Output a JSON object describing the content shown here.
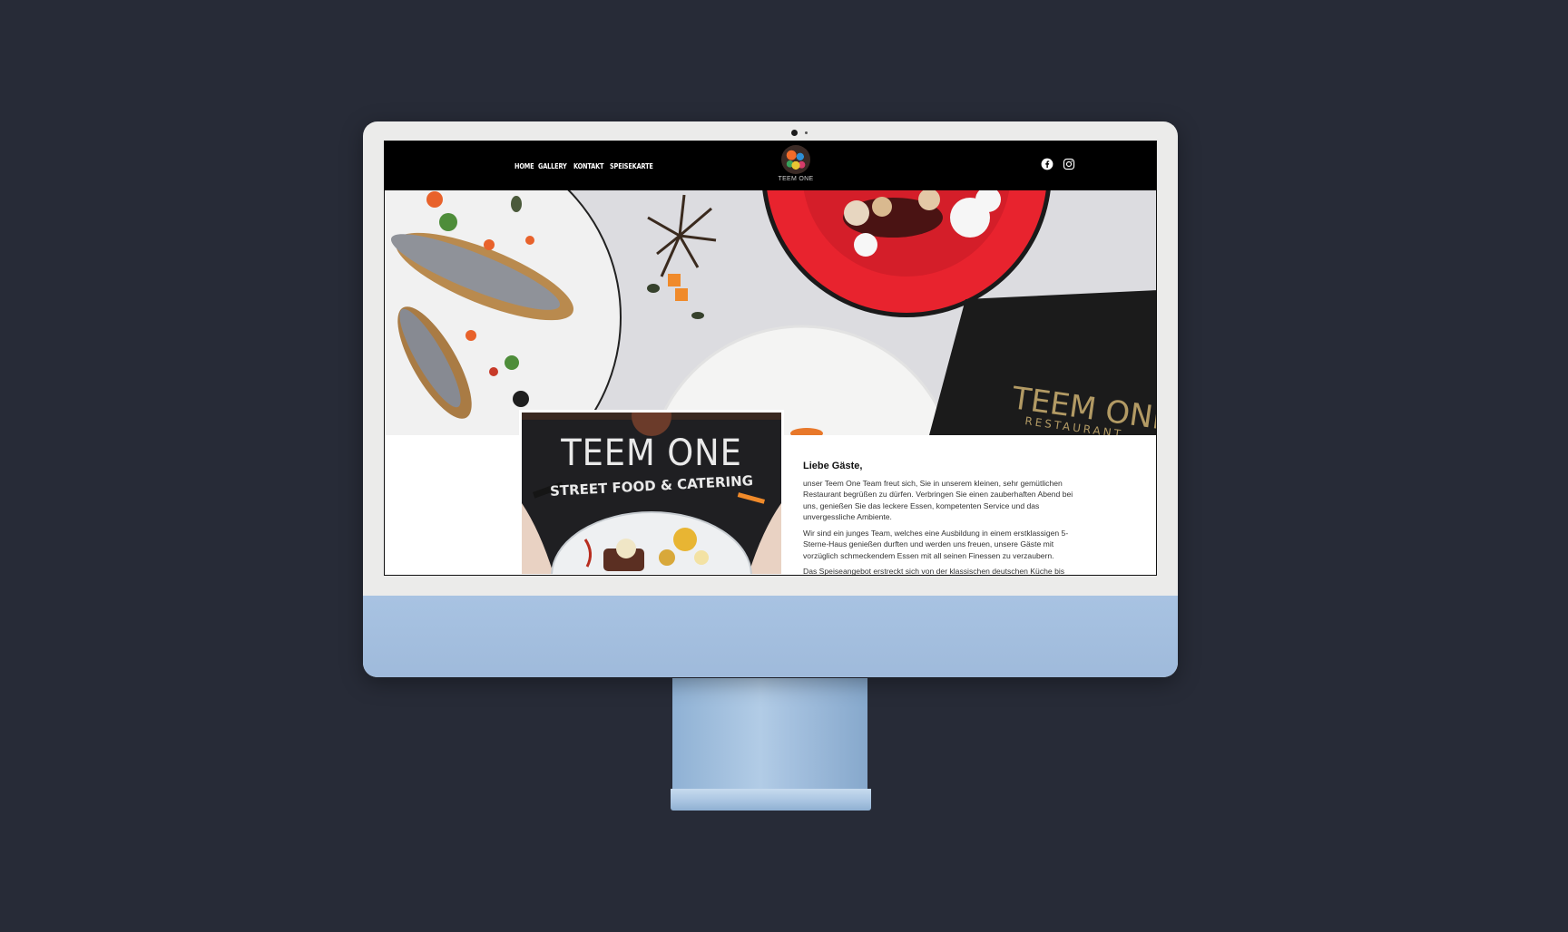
{
  "nav": {
    "items": [
      {
        "label": "HOME"
      },
      {
        "label": "GALLERY"
      },
      {
        "label": "KONTAKT"
      },
      {
        "label": "SPEISEKARTE"
      }
    ]
  },
  "logo": {
    "text": "TEEM ONE"
  },
  "social": {
    "icons": [
      "facebook-icon",
      "instagram-icon"
    ]
  },
  "hero": {
    "menu_book_title": "TEEM ONE",
    "menu_book_sub": "RESTAURANT"
  },
  "photo": {
    "shirt_title": "TEEM ONE",
    "shirt_subtitle": "STREET FOOD & CATERING"
  },
  "content": {
    "greeting": "Liebe Gäste,",
    "paragraphs": [
      "unser Teem One Team freut sich, Sie in unserem kleinen, sehr gemütlichen Restaurant begrüßen zu dürfen. Verbringen Sie einen zauberhaften Abend bei uns, genießen Sie das leckere Essen, kompetenten Service und das unvergessliche Ambiente.",
      "Wir sind ein junges Team, welches eine Ausbildung in einem erstklassigen 5-Sterne-Haus genießen durften und werden uns freuen, unsere Gäste mit vorzüglich schmeckendem Essen mit all seinen Finessen zu verzaubern.",
      "Das Speiseangebot erstreckt sich von der klassischen deutschen Küche bis hin"
    ]
  },
  "colors": {
    "background": "#272b37",
    "header": "#000000",
    "imac_blue": "#a8c3e2",
    "plate_red": "#e8232e"
  }
}
